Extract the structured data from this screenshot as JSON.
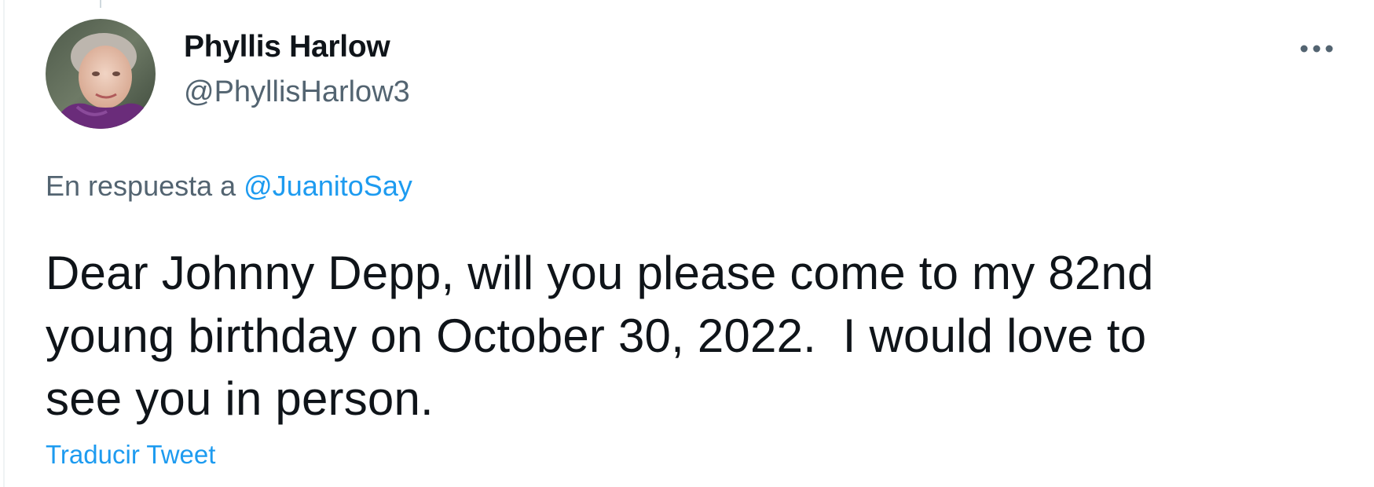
{
  "author": {
    "name": "Phyllis Harlow",
    "handle": "@PhyllisHarlow3"
  },
  "reply": {
    "prefix": "En respuesta a ",
    "mention": "@JuanitoSay"
  },
  "tweet": {
    "text": "Dear Johnny Depp, will you please come to my 82nd\nyoung birthday on October 30, 2022.  I would love to\nsee you in person."
  },
  "actions": {
    "translate_label": "Traducir Tweet",
    "more_icon": "more-horizontal-icon"
  },
  "colors": {
    "link": "#1d9bf0",
    "secondary_text": "#536471",
    "primary_text": "#0f1419"
  }
}
